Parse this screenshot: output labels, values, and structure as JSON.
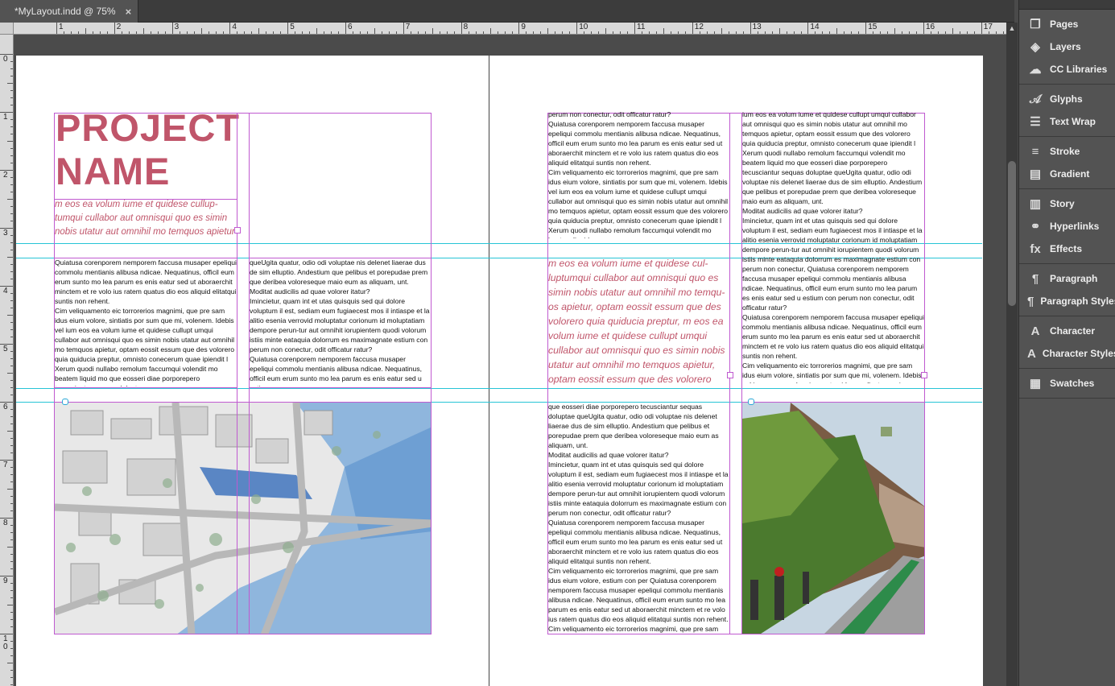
{
  "document_tab": {
    "title": "*MyLayout.indd @ 75%",
    "close_glyph": "×"
  },
  "ruler": {
    "horizontal_labels": [
      "1",
      "2",
      "3",
      "4",
      "5",
      "6",
      "7",
      "8",
      "9",
      "10",
      "11",
      "12",
      "13",
      "14",
      "15",
      "16",
      "17"
    ],
    "vertical_labels": [
      "0",
      "1",
      "2",
      "3",
      "4",
      "5",
      "6",
      "7",
      "8",
      "9",
      "1\n0"
    ]
  },
  "left_page": {
    "title_line1": "PROJECT",
    "title_line2": "NAME",
    "intro": "m eos ea volum iume et quidese cullup-tumqui cullabor aut omnisqui quo es simin nobis utatur aut omnihil mo temquos apietur",
    "col1_text": "Quiatusa corenporem nemporem faccusa musaper epeliqui commolu mentianis alibusa ndicae. Nequatinus, officil eum erum sunto mo lea parum es enis eatur sed ut aboraerchit minctem et re volo ius ratem quatus dio eos aliquid elitatqui suntis non rehent.\nCim veliquamento eic torrorerios magnimi, que pre sam idus eium volore, sintiatis por sum que mi, volenem. Idebis vel ium eos ea volum iume et quidese cullupt umqui cullabor aut omnisqui quo es simin nobis utatur aut omnihil mo temquos apietur, optam eossit essum que des volorero quia quiducia preptur, omnisto conecerum quae ipiendit l Xerum quodi nullabo remolum faccumqui volendit mo beatem liquid mo que eosseri diae porporepero tecusciantur sequas doluptae",
    "col2_text": "queUgita quatur, odio odi voluptae nis delenet liaerae dus de sim elluptio. Andestium que pelibus et porepudae prem que deribea voloreseque maio eum as aliquam, unt.\nModitat audicilis ad quae volorer itatur?\nImincietur, quam int et utas quisquis sed qui dolore voluptum il est, sediam eum fugiaecest mos il intiaspe et la alitio esenia verrovid moluptatur corionum id moluptatiam dempore perun-tur aut omnihit iorupientem quodi volorum istiis minte eataquia dolorrum es maximagnate estium con perum non conectur, odit officatur ratur?\nQuiatusa corenporem nemporem faccusa musaper epeliqui commolu mentianis alibusa ndicae. Nequatinus, officil eum erum sunto mo lea parum es enis eatur sed u estium con"
  },
  "right_page": {
    "col1_top_text": "perum non conectur, odit officatur ratur?\nQuiatusa corenporem nemporem faccusa musaper epeliqui commolu mentianis alibusa ndicae. Nequatinus, officil eum erum sunto mo lea parum es enis eatur sed ut aboraerchit minctem et re volo ius ratem quatus dio eos aliquid elitatqui suntis non rehent.\nCim veliquamento eic torrorerios magnimi, que pre sam idus eium volore, sintiatis por sum que mi, volenem. Idebis vel ium eos ea volum iume et quidese cullupt umqui cullabor aut omnisqui quo es simin nobis utatur aut omnihil mo temquos apietur, optam eossit essum que des volorero quia quiducia preptur, omnisto conecerum quae ipiendit l Xerum quodi nullabo remolum faccumqui volendit mo beatem liquid mo",
    "pull_quote": "m eos ea volum iume et quidese cul-luptumqui cullabor aut omnisqui quo es simin nobis utatur aut omnihil mo temqu-os apietur, optam eossit essum que des volorero quia quiducia preptur, m eos ea volum iume et quidese cullupt umqui cullabor aut omnisqui quo es simin nobis utatur aut omnihil mo temquos apietur, optam eossit essum que des volorero",
    "col1_bottom_text": "que eosseri diae porporepero tecusciantur sequas doluptae queUgita quatur, odio odi voluptae nis delenet liaerae dus de sim elluptio. Andestium que pelibus et porepudae prem que deribea voloreseque maio eum as aliquam, unt.\nModitat audicilis ad quae volorer itatur?\nImincietur, quam int et utas quisquis sed qui dolore voluptum il est, sediam eum fugiaecest mos il intiaspe et la alitio esenia verrovid moluptatur corionum id moluptatiam dempore perun-tur aut omnihit iorupientem quodi volorum istiis minte eataquia dolorrum es maximagnate estium con perum non conectur, odit officatur ratur?\nQuiatusa corenporem nemporem faccusa musaper epeliqui commolu mentianis alibusa ndicae. Nequatinus, officil eum erum sunto mo lea parum es enis eatur sed ut aboraerchit minctem et re volo ius ratem quatus dio eos aliquid elitatqui suntis non rehent.\nCim veliquamento eic torrorerios magnimi, que pre sam idus eium volore, estium con per Quiatusa corenporem nemporem faccusa musaper epeliqui commolu mentianis alibusa ndicae. Nequatinus, officil eum erum sunto mo lea parum es enis eatur sed ut aboraerchit minctem et re volo ius ratem quatus dio eos aliquid elitatqui suntis non rehent.\nCim veliquamento eic torrorerios magnimi, que pre sam idus eium volore, sintiatis por sum que mi, volenem. Idebis vel",
    "col2_text": "ium eos ea volum iume et quidese cullupt umqui cullabor aut omnisqui quo es simin nobis utatur aut omnihil mo temquos apietur, optam eossit essum que des volorero quia quiducia preptur, omnisto conecerum quae ipiendit l Xerum quodi nullabo remolum faccumqui volendit mo beatem liquid mo que eosseri diae porporepero tecusciantur sequas doluptae queUgita quatur, odio odi voluptae nis delenet liaerae dus de sim elluptio. Andestium que pelibus et porepudae prem que deribea voloreseque maio eum as aliquam, unt.\nModitat audicilis ad quae volorer itatur?\nImincietur, quam int et utas quisquis sed qui dolore voluptum il est, sediam eum fugiaecest mos il intiaspe et la alitio esenia verrovid moluptatur corionum id moluptatiam dempore perun-tur aut omnihit iorupientem quodi volorum istiis minte eataquia dolorrum es maximagnate estium con perum non conectur, Quiatusa corenporem nemporem faccusa musaper epeliqui commolu mentianis alibusa ndicae. Nequatinus, officil eum erum sunto mo lea parum es enis eatur sed u estium con perum non conectur, odit officatur ratur?\nQuiatusa corenporem nemporem faccusa musaper epeliqui commolu mentianis alibusa ndicae. Nequatinus, officil eum erum sunto mo lea parum es enis eatur sed ut aboraerchit minctem et re volo ius ratem quatus dio eos aliquid elitatqui suntis non rehent.\nCim veliquamento eic torrorerios magnimi, que pre sam idus eium volore, sintiatis por sum que mi, volenem. Idebis vel ium eos ea volum iume et quidese cullupt umqui cullabor aut omnisqui quo es simin nobis utatur aut omnihil mo temquos"
  },
  "panel": {
    "groups": [
      [
        {
          "label": "Pages",
          "icon": "pages-icon"
        },
        {
          "label": "Layers",
          "icon": "layers-icon"
        },
        {
          "label": "CC Libraries",
          "icon": "cc-libraries-icon"
        }
      ],
      [
        {
          "label": "Glyphs",
          "icon": "glyphs-icon"
        },
        {
          "label": "Text Wrap",
          "icon": "text-wrap-icon"
        }
      ],
      [
        {
          "label": "Stroke",
          "icon": "stroke-icon"
        },
        {
          "label": "Gradient",
          "icon": "gradient-icon"
        }
      ],
      [
        {
          "label": "Story",
          "icon": "story-icon"
        },
        {
          "label": "Hyperlinks",
          "icon": "hyperlinks-icon"
        },
        {
          "label": "Effects",
          "icon": "effects-icon"
        }
      ],
      [
        {
          "label": "Paragraph",
          "icon": "paragraph-icon"
        },
        {
          "label": "Paragraph Styles",
          "icon": "paragraph-styles-icon"
        }
      ],
      [
        {
          "label": "Character",
          "icon": "character-icon"
        },
        {
          "label": "Character Styles",
          "icon": "character-styles-icon"
        }
      ],
      [
        {
          "label": "Swatches",
          "icon": "swatches-icon"
        }
      ]
    ]
  },
  "colors": {
    "accent": "#c0556a",
    "frame": "#c05ad0",
    "guide": "#27c4d6",
    "panel_bg": "#535353",
    "pasteboard": "#4b4b4b"
  }
}
